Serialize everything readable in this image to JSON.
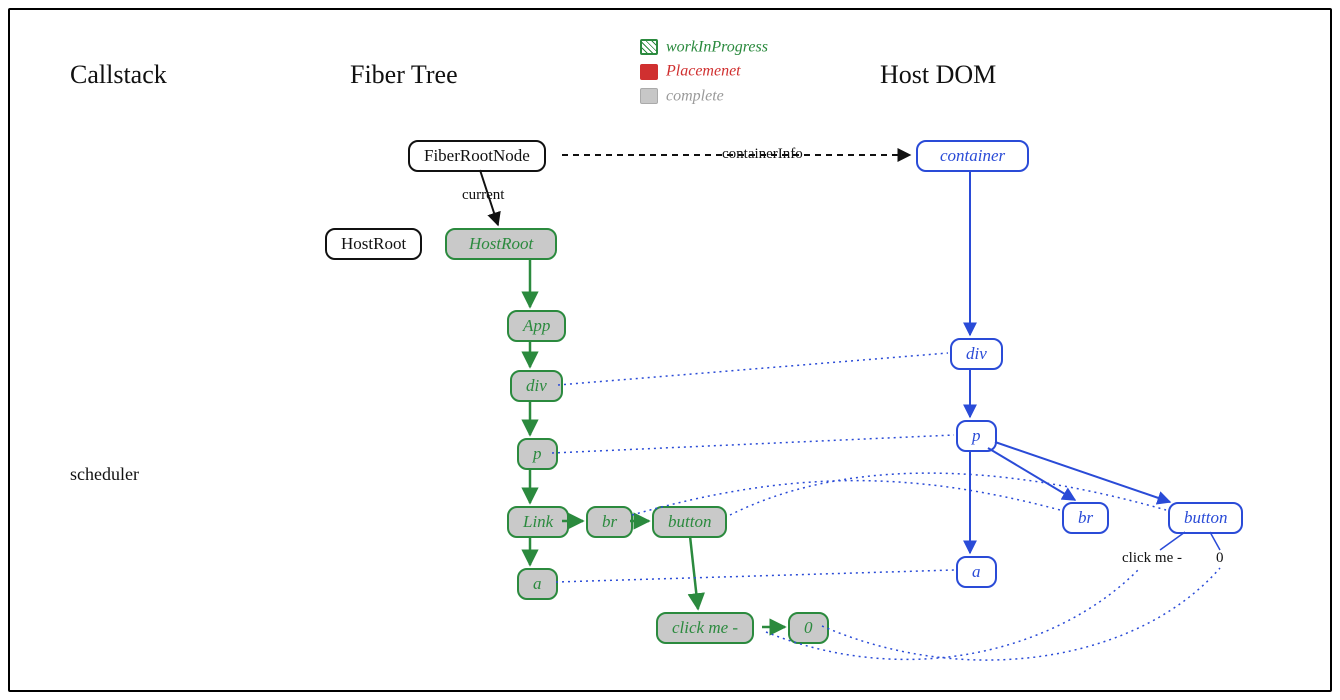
{
  "headings": {
    "callstack": "Callstack",
    "fiberTree": "Fiber Tree",
    "hostDom": "Host DOM",
    "scheduler": "scheduler"
  },
  "legend": {
    "wip": "workInProgress",
    "placement": "Placemenet",
    "complete": "complete"
  },
  "edges": {
    "containerInfo": "containerInfo",
    "current": "current"
  },
  "callstack": {
    "hostRoot": "HostRoot"
  },
  "fiber": {
    "fiberRootNode": "FiberRootNode",
    "hostRoot": "HostRoot",
    "app": "App",
    "div": "div",
    "p": "p",
    "link": "Link",
    "br": "br",
    "button": "button",
    "a": "a",
    "clickMe": "click me -",
    "zero": "0"
  },
  "dom": {
    "container": "container",
    "div": "div",
    "p": "p",
    "a": "a",
    "br": "br",
    "button": "button",
    "clickMe": "click me -",
    "zero": "0"
  }
}
